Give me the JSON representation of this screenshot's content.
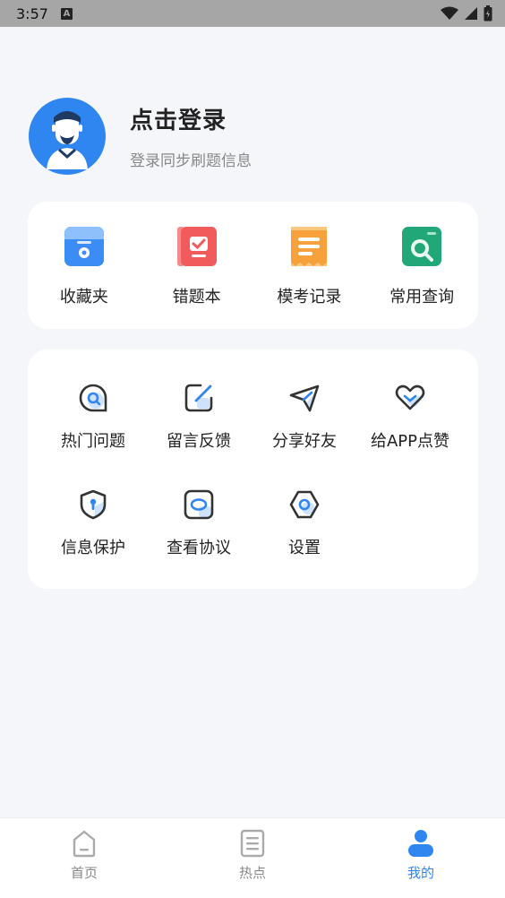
{
  "status_bar": {
    "time": "3:57",
    "notification_icon": "A"
  },
  "profile": {
    "title": "点击登录",
    "subtitle": "登录同步刷题信息",
    "avatar_icon": "user-avatar-icon"
  },
  "quick_links": [
    {
      "label": "收藏夹",
      "icon": "favorites-icon"
    },
    {
      "label": "错题本",
      "icon": "wrong-questions-book-icon"
    },
    {
      "label": "模考记录",
      "icon": "mock-exam-record-icon"
    },
    {
      "label": "常用查询",
      "icon": "common-query-icon"
    }
  ],
  "tools": [
    {
      "label": "热门问题",
      "icon": "chat-question-icon"
    },
    {
      "label": "留言反馈",
      "icon": "edit-feedback-icon"
    },
    {
      "label": "分享好友",
      "icon": "paper-plane-icon"
    },
    {
      "label": "给APP点赞",
      "icon": "heart-like-icon"
    },
    {
      "label": "信息保护",
      "icon": "shield-lock-icon"
    },
    {
      "label": "查看协议",
      "icon": "agreement-icon"
    },
    {
      "label": "设置",
      "icon": "settings-hexagon-icon"
    }
  ],
  "tabbar": [
    {
      "label": "首页",
      "icon": "home-icon",
      "active": false
    },
    {
      "label": "热点",
      "icon": "document-icon",
      "active": false
    },
    {
      "label": "我的",
      "icon": "person-icon",
      "active": true
    }
  ],
  "colors": {
    "accent": "#2f86f1",
    "background": "#f5f6fa",
    "card": "#ffffff"
  }
}
